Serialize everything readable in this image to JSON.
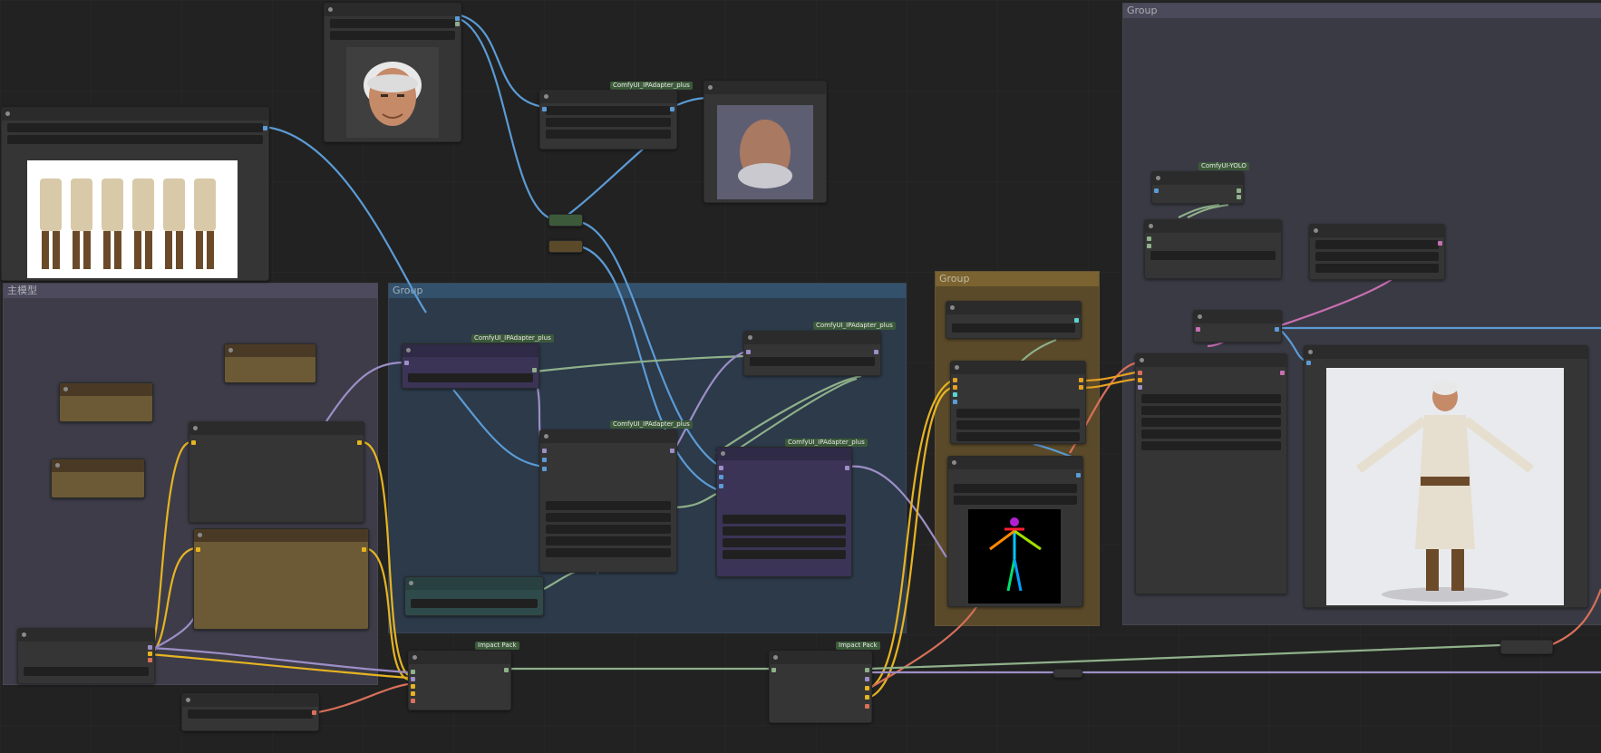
{
  "groups": {
    "top_right": "Group",
    "main_model": "主模型",
    "middle": "Group",
    "pose": "Group"
  },
  "tags": {
    "ipadapter": "ComfyUI_IPAdapter_plus",
    "yolo": "ComfyUI-YOLO",
    "impact": "Impact Pack"
  },
  "colors": {
    "wire_blue": "#5b9bd5",
    "wire_yellow": "#e6b422",
    "wire_purple": "#9d8ec7",
    "wire_red": "#d8705a",
    "wire_green": "#8fb08a",
    "wire_pink": "#c76fb2"
  }
}
